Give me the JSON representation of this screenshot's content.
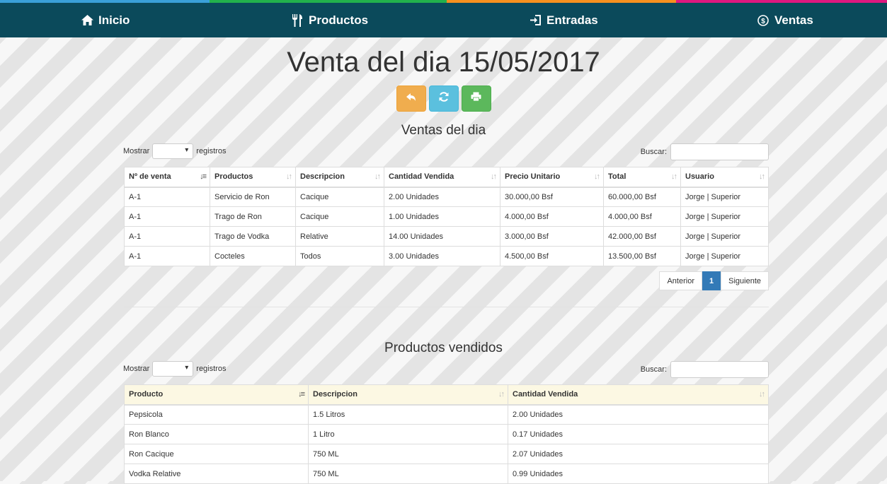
{
  "strip_colors": [
    "#3aa0d8",
    "#22b14c",
    "#f7901e",
    "#e0177f"
  ],
  "nav": {
    "items": [
      {
        "label": "Inicio",
        "icon": "home-icon"
      },
      {
        "label": "Productos",
        "icon": "cutlery-icon"
      },
      {
        "label": "Entradas",
        "icon": "log-in-icon"
      },
      {
        "label": "Ventas",
        "icon": "coin-icon"
      }
    ]
  },
  "page": {
    "title": "Venta del dia 15/05/2017"
  },
  "toolbar": {
    "back_icon": "back-arrow-icon",
    "refresh_icon": "refresh-icon",
    "print_icon": "print-icon"
  },
  "sales": {
    "section_title": "Ventas del dia",
    "length_label_pre": "Mostrar",
    "length_label_post": "registros",
    "length_value": "",
    "search_label": "Buscar:",
    "search_value": "",
    "headers": [
      "Nº de venta",
      "Productos",
      "Descripcion",
      "Cantidad Vendida",
      "Precio Unitario",
      "Total",
      "Usuario"
    ],
    "rows": [
      [
        "A-1",
        "Servicio de Ron",
        "Cacique",
        "2.00 Unidades",
        "30.000,00 Bsf",
        "60.000,00 Bsf",
        "Jorge | Superior"
      ],
      [
        "A-1",
        "Trago de Ron",
        "Cacique",
        "1.00 Unidades",
        "4.000,00 Bsf",
        "4.000,00 Bsf",
        "Jorge | Superior"
      ],
      [
        "A-1",
        "Trago de Vodka",
        "Relative",
        "14.00 Unidades",
        "3.000,00 Bsf",
        "42.000,00 Bsf",
        "Jorge | Superior"
      ],
      [
        "A-1",
        "Cocteles",
        "Todos",
        "3.00 Unidades",
        "4.500,00 Bsf",
        "13.500,00 Bsf",
        "Jorge | Superior"
      ]
    ],
    "pagination": {
      "prev": "Anterior",
      "current": "1",
      "next": "Siguiente"
    }
  },
  "products": {
    "section_title": "Productos vendidos",
    "length_label_pre": "Mostrar",
    "length_label_post": "registros",
    "length_value": "",
    "search_label": "Buscar:",
    "search_value": "",
    "headers": [
      "Producto",
      "Descripcion",
      "Cantidad Vendida"
    ],
    "rows": [
      [
        "Pepsicola",
        "1.5 Litros",
        "2.00 Unidades"
      ],
      [
        "Ron Blanco",
        "1 Litro",
        "0.17 Unidades"
      ],
      [
        "Ron Cacique",
        "750 ML",
        "2.07 Unidades"
      ],
      [
        "Vodka Relative",
        "750 ML",
        "0.99 Unidades"
      ]
    ]
  }
}
